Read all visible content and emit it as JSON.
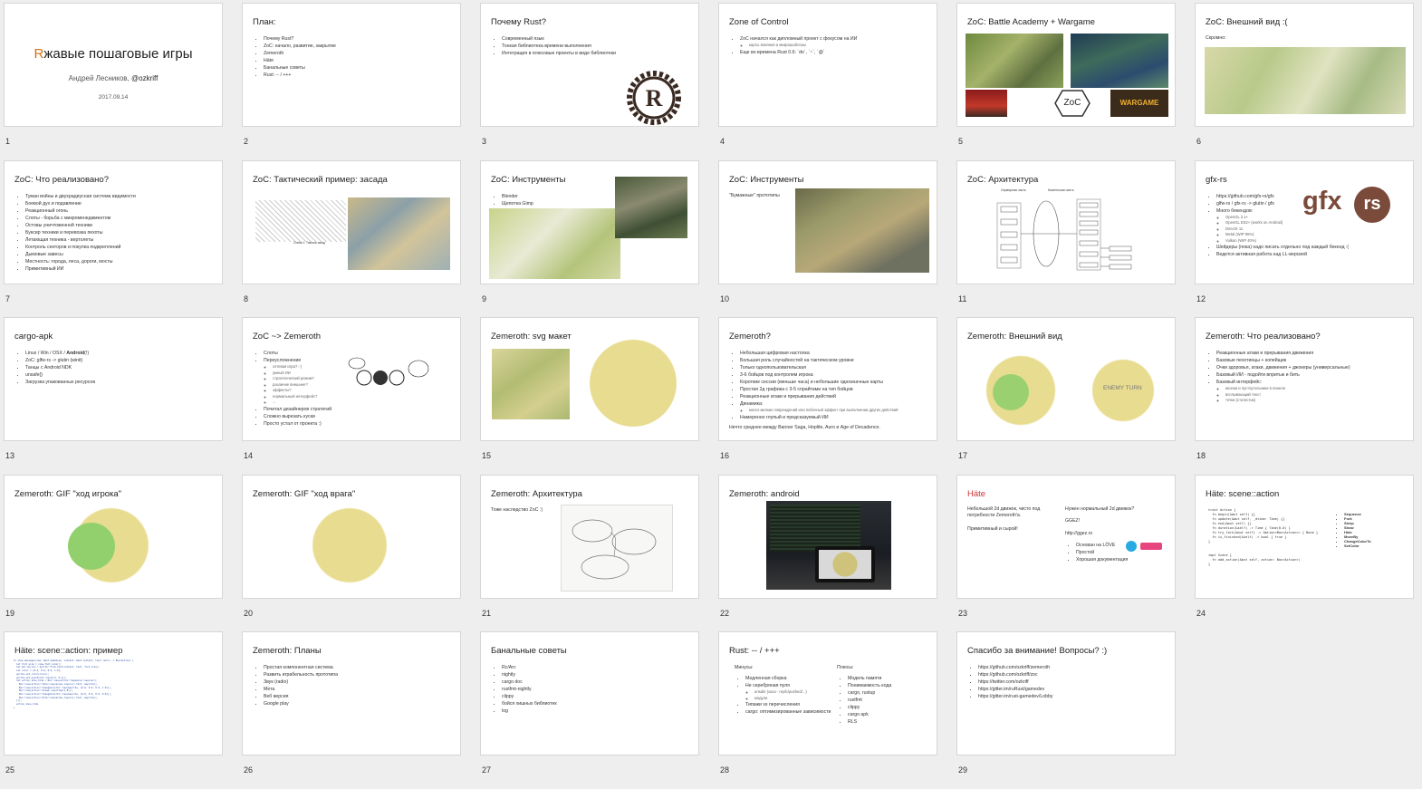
{
  "slides": [
    {
      "num": "1",
      "title_r": "R",
      "title_rest": "жавые пошаговые игры",
      "author": "Андрей Лесников, ",
      "handle": "@ozkriff",
      "date": "2017.09.14"
    },
    {
      "num": "2",
      "title": "План:",
      "bullets": [
        "Почему Rust?",
        "ZoC: начало, развитие, закрытие",
        "Zemeroth",
        "Häte",
        "Банальные советы",
        "Rust: -- / +++"
      ]
    },
    {
      "num": "3",
      "title": "Почему Rust?",
      "bullets": [
        "Современный язык",
        "Тонкая библиотека времени выполнения",
        "Интеграция в плюсовые проекты в виде библиотеки"
      ]
    },
    {
      "num": "4",
      "title": "Zone of Control",
      "bullets": [
        "ZoC начался как дипломный проект с фокусом на ИИ",
        "Еще во времена Rust 0.6: `do`, `~`, `@`"
      ],
      "sub": "карты влияния и микрошаблоны"
    },
    {
      "num": "5",
      "title": "ZoC: Battle Academy + Wargame",
      "logo": "ZoC",
      "wargame": "WARGAME"
    },
    {
      "num": "6",
      "title": "ZoC: Внешний вид :(",
      "text": "Скромно:"
    },
    {
      "num": "7",
      "title": "ZoC: Что реализовано?",
      "bullets": [
        "Туман войны и двухрадиусная система видимости",
        "Боевой дух и подавление",
        "Реакционный огонь",
        "Слоты - борьба с микроменеджментом",
        "Остовы уничтоженной техники",
        "Буксир техники и перевозка пехоты",
        "Летающая техника - вертолеты",
        "Контроль секторов и покупка подкреплений",
        "Дымовые завесы",
        "Местность: города, леса, дороги, мосты",
        "Примитивный ИИ"
      ]
    },
    {
      "num": "8",
      "title": "ZoC: Тактический пример: засада",
      "caption": "Схема 1. Тактика засад"
    },
    {
      "num": "9",
      "title": "ZoC: Инструменты",
      "bullets": [
        "Blender",
        "Щепотка Gimp"
      ]
    },
    {
      "num": "10",
      "title": "ZoC: Инструменты",
      "text": "\"Бумажные\" прототипы"
    },
    {
      "num": "11",
      "title": "ZoC: Архитектура",
      "left_label": "Серверная часть",
      "right_label": "Клиентская часть"
    },
    {
      "num": "12",
      "title": "gfx-rs",
      "bullets": [
        "https://github.com/gfx-rs/gfx",
        "glfw-rs / gfx-rs -> glutin / gfx",
        "Много бекендов:",
        "Шейдеры (пока) надо писать отдельно под каждый бекенд :(",
        "Ведется активная работа над LL-версией"
      ],
      "backends": [
        "OpenGL 2.1+",
        "OpenGL ES2+ (works on Android)",
        "DirectX 11",
        "Metal (WIP 95%)",
        "Vulkan (WIP 40%)"
      ],
      "logo_a": "gfx",
      "logo_b": "rs"
    },
    {
      "num": "13",
      "title": "cargo-apk",
      "bullets_rich": [
        {
          "pre": "Linux / Win / OSX / ",
          "bold": "Android",
          "post": "(!)"
        },
        {
          "pre": "ZoC: glfw-rs -> glutin (winit)",
          "bold": "",
          "post": ""
        },
        {
          "pre": "Танцы с Android NDK",
          "bold": "",
          "post": ""
        },
        {
          "pre": "unsafe{}",
          "bold": "",
          "post": ""
        },
        {
          "pre": "Загрузка упакованных ресурсов",
          "bold": "",
          "post": ""
        }
      ]
    },
    {
      "num": "14",
      "title": "ZoC ~> Zemeroth",
      "bullets": [
        "Слоты",
        "Переусложнение",
        "Почитал дизайнеров стратегий",
        "Сложно вырезать куски",
        "Просто устал от проекта :)"
      ],
      "subs": [
        "сетевая игра? :-|",
        "умный ИИ",
        "стратегический режим?",
        "различие внешнее?",
        "эффекты?",
        "нормальный интерфейс?",
        "..."
      ]
    },
    {
      "num": "15",
      "title": "Zemeroth: svg макет"
    },
    {
      "num": "16",
      "title": "Zemeroth?",
      "bullets": [
        "Небольшая цифровая настолка",
        "Большая роль случайностей на тактическом уровне",
        "Только однопользовательская",
        "3-6 бойцов под контролем игрока",
        "Короткие сессии (меньше часа) и небольшие однозначные карты",
        "Простая 2д графика с 3-5 спрайтами на тип бойцов",
        "Реакционные атаки и прерывания действий",
        "Динамика:",
        "Намеренно глупый и предсказуемый ИИ"
      ],
      "sub": "много мелких повреждений или побочный эффект при выполнении других действий",
      "footer": "Нечто среднее между Banner Saga, Hoplite, Auro и Age of Decadence."
    },
    {
      "num": "17",
      "title": "Zemeroth: Внешний вид",
      "enemy": "ENEMY TURN"
    },
    {
      "num": "18",
      "title": "Zemeroth: Что реализовано?",
      "bullets": [
        "Реакционные атаки и прерывания движения",
        "Базовые пехотинцы + копейщик",
        "Очки здоровья, атаки, движения + джокеры (универсальные)",
        "Базовый ИИ - подойти впритык и бить",
        "Базовый интерфейс:"
      ],
      "subs": [
        "иконки и пустоугольники в панели",
        "всплывающий текст",
        "точки (статистик)"
      ]
    },
    {
      "num": "19",
      "title": "Zemeroth: GIF \"ход игрока\""
    },
    {
      "num": "20",
      "title": "Zemeroth: GIF \"ход врага\""
    },
    {
      "num": "21",
      "title": "Zemeroth: Архитектура",
      "text": "Тоже наследство ZoC :)"
    },
    {
      "num": "22",
      "title": "Zemeroth: android"
    },
    {
      "num": "23",
      "title": "Häte",
      "left_text": "Небольшой 2d движок, чисто под потребности Zemeroth'а.",
      "left_text2": "Примитивный и сырой!",
      "right_text": "Нужен нормальный 2d движок?",
      "ggez": "GGEZ!",
      "url": "http://ggez.rs",
      "bullets": [
        "Основан на LÖVE",
        "Простой",
        "Хорошая документация"
      ]
    },
    {
      "num": "24",
      "title": "Häte: scene::action",
      "code": "trait Action {\n  fn begin(&mut self) {}\n  fn update(&mut self, _dtime: Time) {}\n  fn end(&mut self) {}\n  fn duration(&self) -> Time { Time(0.0) }\n  fn try_fork(&mut self) -> Option<Box<Action>> { None }\n  fn is_finished(&self) -> bool { true }\n}\n\n\nimpl Scene {\n  fn add_action(&mut self, action: Box<Action>)\n}",
      "items": [
        "Sequence",
        "Fork",
        "Sleep",
        "Show",
        "Hide",
        "MoveBy",
        "ChangeColorTo",
        "SetColor"
      ]
    },
    {
      "num": "25",
      "title": "Häte: scene::action: пример",
      "code": "fn show_message(view: &mut GameView, context: &mut Context, text: &str) -> Box<Action> {\n  let font_size = view.font_size();\n  let mut sprite = Sprite::from_text(context, text, font_size);\n  let color = [0.0, 0.0, 0.0, 1.0];\n  sprite.set_color(color);\n  sprite.set_pos(Point::new(0.0, 0.1));\n  let action_show_hide = Box::new(action::Sequence::new(vec![\n    Box::new(action::Show::new(&view.layers().text, &sprite)),\n    Box::new(action::ChangeColorTo::new(&sprite, [0.0, 0.0, 0.0, 1.0])),\n    Box::new(action::Sleep::new(Time(1.0))),\n    Box::new(action::ChangeColorTo::new(&sprite, [0.0, 0.0, 0.0, 0.0])),\n    Box::new(action::Hide::new(&view.layers().text, &sprite)),\n  ]));\n  action_show_hide\n}"
    },
    {
      "num": "26",
      "title": "Zemeroth: Планы",
      "bullets": [
        "Простая компонентная система",
        "Развить играбельность прототипа",
        "Звук (radio)",
        "Мета",
        "Веб версия",
        "Google play"
      ]
    },
    {
      "num": "27",
      "title": "Банальные советы",
      "bullets": [
        "Rc/Arc",
        "nightly",
        "cargo doc",
        "rustfmt-nightly",
        "clippy",
        "бойся хишных библиотек",
        "log"
      ]
    },
    {
      "num": "28",
      "title": "Rust: -- / +++",
      "minus_label": "Минусы:",
      "minus": [
        "Медленная сборка",
        "Не серебряная пуля",
        "Типажи vs перечисления",
        "cargo: оптимизированные зависимости"
      ],
      "minus_subs": [
        "unsafe (хаоз - герfc/pushed/...)",
        "модули"
      ],
      "plus_label": "Плюсы:",
      "plus": [
        "Модель памяти",
        "Понимаемость кода",
        "cargo, rustup",
        "rustfmt",
        "clippy",
        "cargo apk",
        "RLS"
      ]
    },
    {
      "num": "29",
      "title": "Спасибо за внимание! Вопросы? :)",
      "bullets": [
        "https://github.com/ozkriff/zemeroth",
        "https://github.com/ozkriff/zoc",
        "https://twitter.com/ozkriff",
        "https://gitter.im/ruRust/gamedev",
        "https://gitter.im/rust-gamedev/Lobby"
      ]
    }
  ]
}
